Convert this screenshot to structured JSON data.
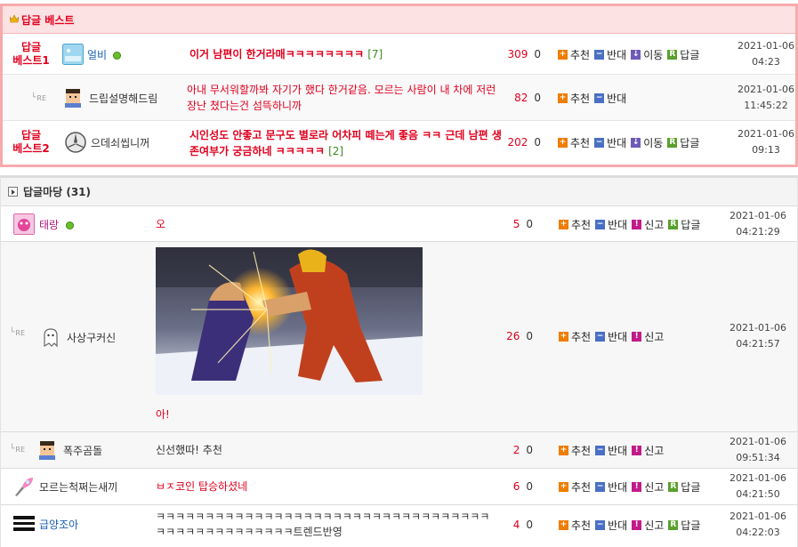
{
  "best": {
    "heading": "답글 베스트",
    "rows": [
      {
        "rank_line1": "답글",
        "rank_line2": "베스트1",
        "is_reply": false,
        "nick": "얼비",
        "online": true,
        "title": "이거 남편이 한거라매ㅋㅋㅋㅋㅋㅋㅋㅋ",
        "comments": "[7]",
        "up": "309",
        "down": "0",
        "actions": [
          "추천",
          "반대",
          "이동",
          "답글"
        ],
        "date": "2021-01-06",
        "time": "04:23"
      },
      {
        "rank_line1": "",
        "rank_line2": "",
        "is_reply": true,
        "re": "RE",
        "nick": "드립설명해드림",
        "online": false,
        "title": "아내 무서워할까봐 자기가 했다 한거같음. 모르는 사람이 내 차에 저런 장난 쳤다는건 섬뜩하니까",
        "comments": "",
        "up": "82",
        "down": "0",
        "actions": [
          "추천",
          "반대"
        ],
        "date": "2021-01-06",
        "time": "11:45:22"
      },
      {
        "rank_line1": "답글",
        "rank_line2": "베스트2",
        "is_reply": false,
        "nick": "으데쇠씹니꺼",
        "online": false,
        "title": "시인성도 안좋고 문구도 별로라 어차피 떼는게 좋음 ㅋㅋ 근데 남편 생존여부가 궁금하네 ㅋㅋㅋㅋㅋ",
        "comments": "[2]",
        "up": "202",
        "down": "0",
        "actions": [
          "추천",
          "반대",
          "이동",
          "답글"
        ],
        "date": "2021-01-06",
        "time": "09:13"
      }
    ]
  },
  "forum": {
    "heading": "답글마당 (31)",
    "rows": [
      {
        "is_reply": false,
        "nick": "태랑",
        "online": true,
        "title": "오",
        "up": "5",
        "down": "0",
        "actions": [
          "추천",
          "반대",
          "신고",
          "답글"
        ],
        "date": "2021-01-06",
        "time": "04:21:29"
      },
      {
        "is_reply": true,
        "re": "RE",
        "nick": "사상구커신",
        "online": false,
        "title": "아!",
        "has_image": true,
        "up": "26",
        "down": "0",
        "actions": [
          "추천",
          "반대",
          "신고"
        ],
        "date": "2021-01-06",
        "time": "04:21:57"
      },
      {
        "is_reply": true,
        "re": "RE",
        "nick": "폭주곰돌",
        "online": false,
        "title": "신선했따! 추천",
        "up": "2",
        "down": "0",
        "actions": [
          "추천",
          "반대",
          "신고"
        ],
        "date": "2021-01-06",
        "time": "09:51:34"
      },
      {
        "is_reply": false,
        "nick": "모르는척쩌는새끼",
        "online": false,
        "title": "ㅂㅈ코인 탑승하셨네",
        "up": "6",
        "down": "0",
        "actions": [
          "추천",
          "반대",
          "신고",
          "답글"
        ],
        "date": "2021-01-06",
        "time": "04:21:50"
      },
      {
        "is_reply": false,
        "nick": "급양조아",
        "online": false,
        "title": "ㅋㅋㅋㅋㅋㅋㅋㅋㅋㅋㅋㅋㅋㅋㅋㅋㅋㅋㅋㅋㅋㅋㅋㅋㅋㅋㅋㅋㅋㅋㅋㅋㅋㅋㅋㅋㅋㅋㅋㅋㅋㅋㅋㅋㅋㅋㅋㅋ트렌드반영",
        "up": "4",
        "down": "0",
        "actions": [
          "추천",
          "반대",
          "신고",
          "답글"
        ],
        "date": "2021-01-06",
        "time": "04:22:03"
      }
    ]
  },
  "colors": {
    "accent_red": "#e1001e",
    "best_border": "#f7a9ac",
    "best_header_bg": "#fde2e3",
    "comment_green": "#3a8a1e",
    "nick_blue": "#1a5fb4"
  }
}
